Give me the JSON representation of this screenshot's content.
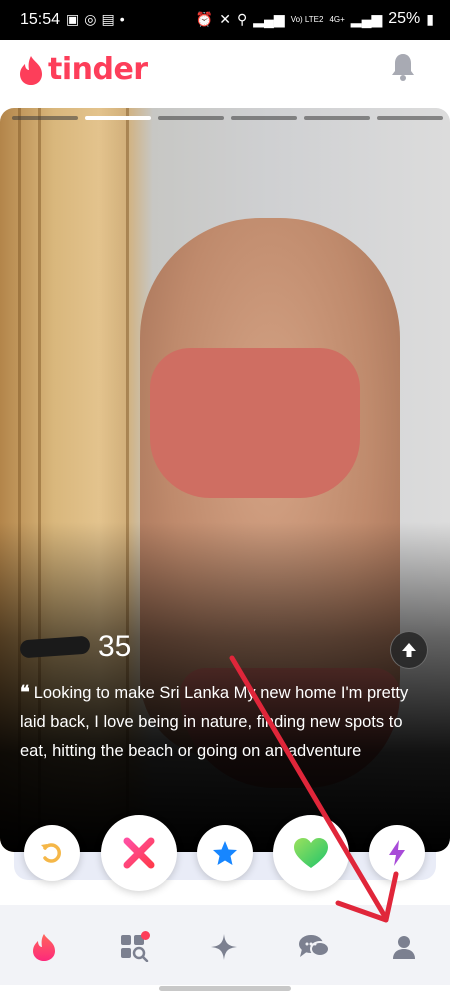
{
  "status_bar": {
    "time": "15:54",
    "network_label": "Vo) LTE2",
    "network_gen": "4G+",
    "battery": "25%"
  },
  "header": {
    "app_name": "tinder",
    "brand_color": "#fd3e5a",
    "notification_icon": "bell-icon"
  },
  "card": {
    "photo_count": 6,
    "active_photo_index": 1,
    "age": "35",
    "bio": "Looking to make Sri Lanka My new home I'm pretty laid back, I love being in nature, finding new spots to eat, hitting the beach or going on an adventure",
    "info_icon": "arrow-up-icon"
  },
  "actions": [
    {
      "name": "rewind",
      "icon": "rewind-icon",
      "color": "#f5b748"
    },
    {
      "name": "nope",
      "icon": "x-icon",
      "color": "#ff4458"
    },
    {
      "name": "super-like",
      "icon": "star-icon",
      "color": "#1786ff"
    },
    {
      "name": "like",
      "icon": "heart-icon",
      "color": "#3ad06c"
    },
    {
      "name": "boost",
      "icon": "bolt-icon",
      "color": "#a84bd8"
    }
  ],
  "bottom_nav": [
    {
      "name": "home",
      "icon": "flame-icon",
      "active": true
    },
    {
      "name": "explore",
      "icon": "grid-search-icon",
      "badge": true
    },
    {
      "name": "spark",
      "icon": "sparkle-icon"
    },
    {
      "name": "messages",
      "icon": "chat-icon"
    },
    {
      "name": "profile",
      "icon": "person-icon"
    }
  ],
  "annotation_color": "#e0263a"
}
